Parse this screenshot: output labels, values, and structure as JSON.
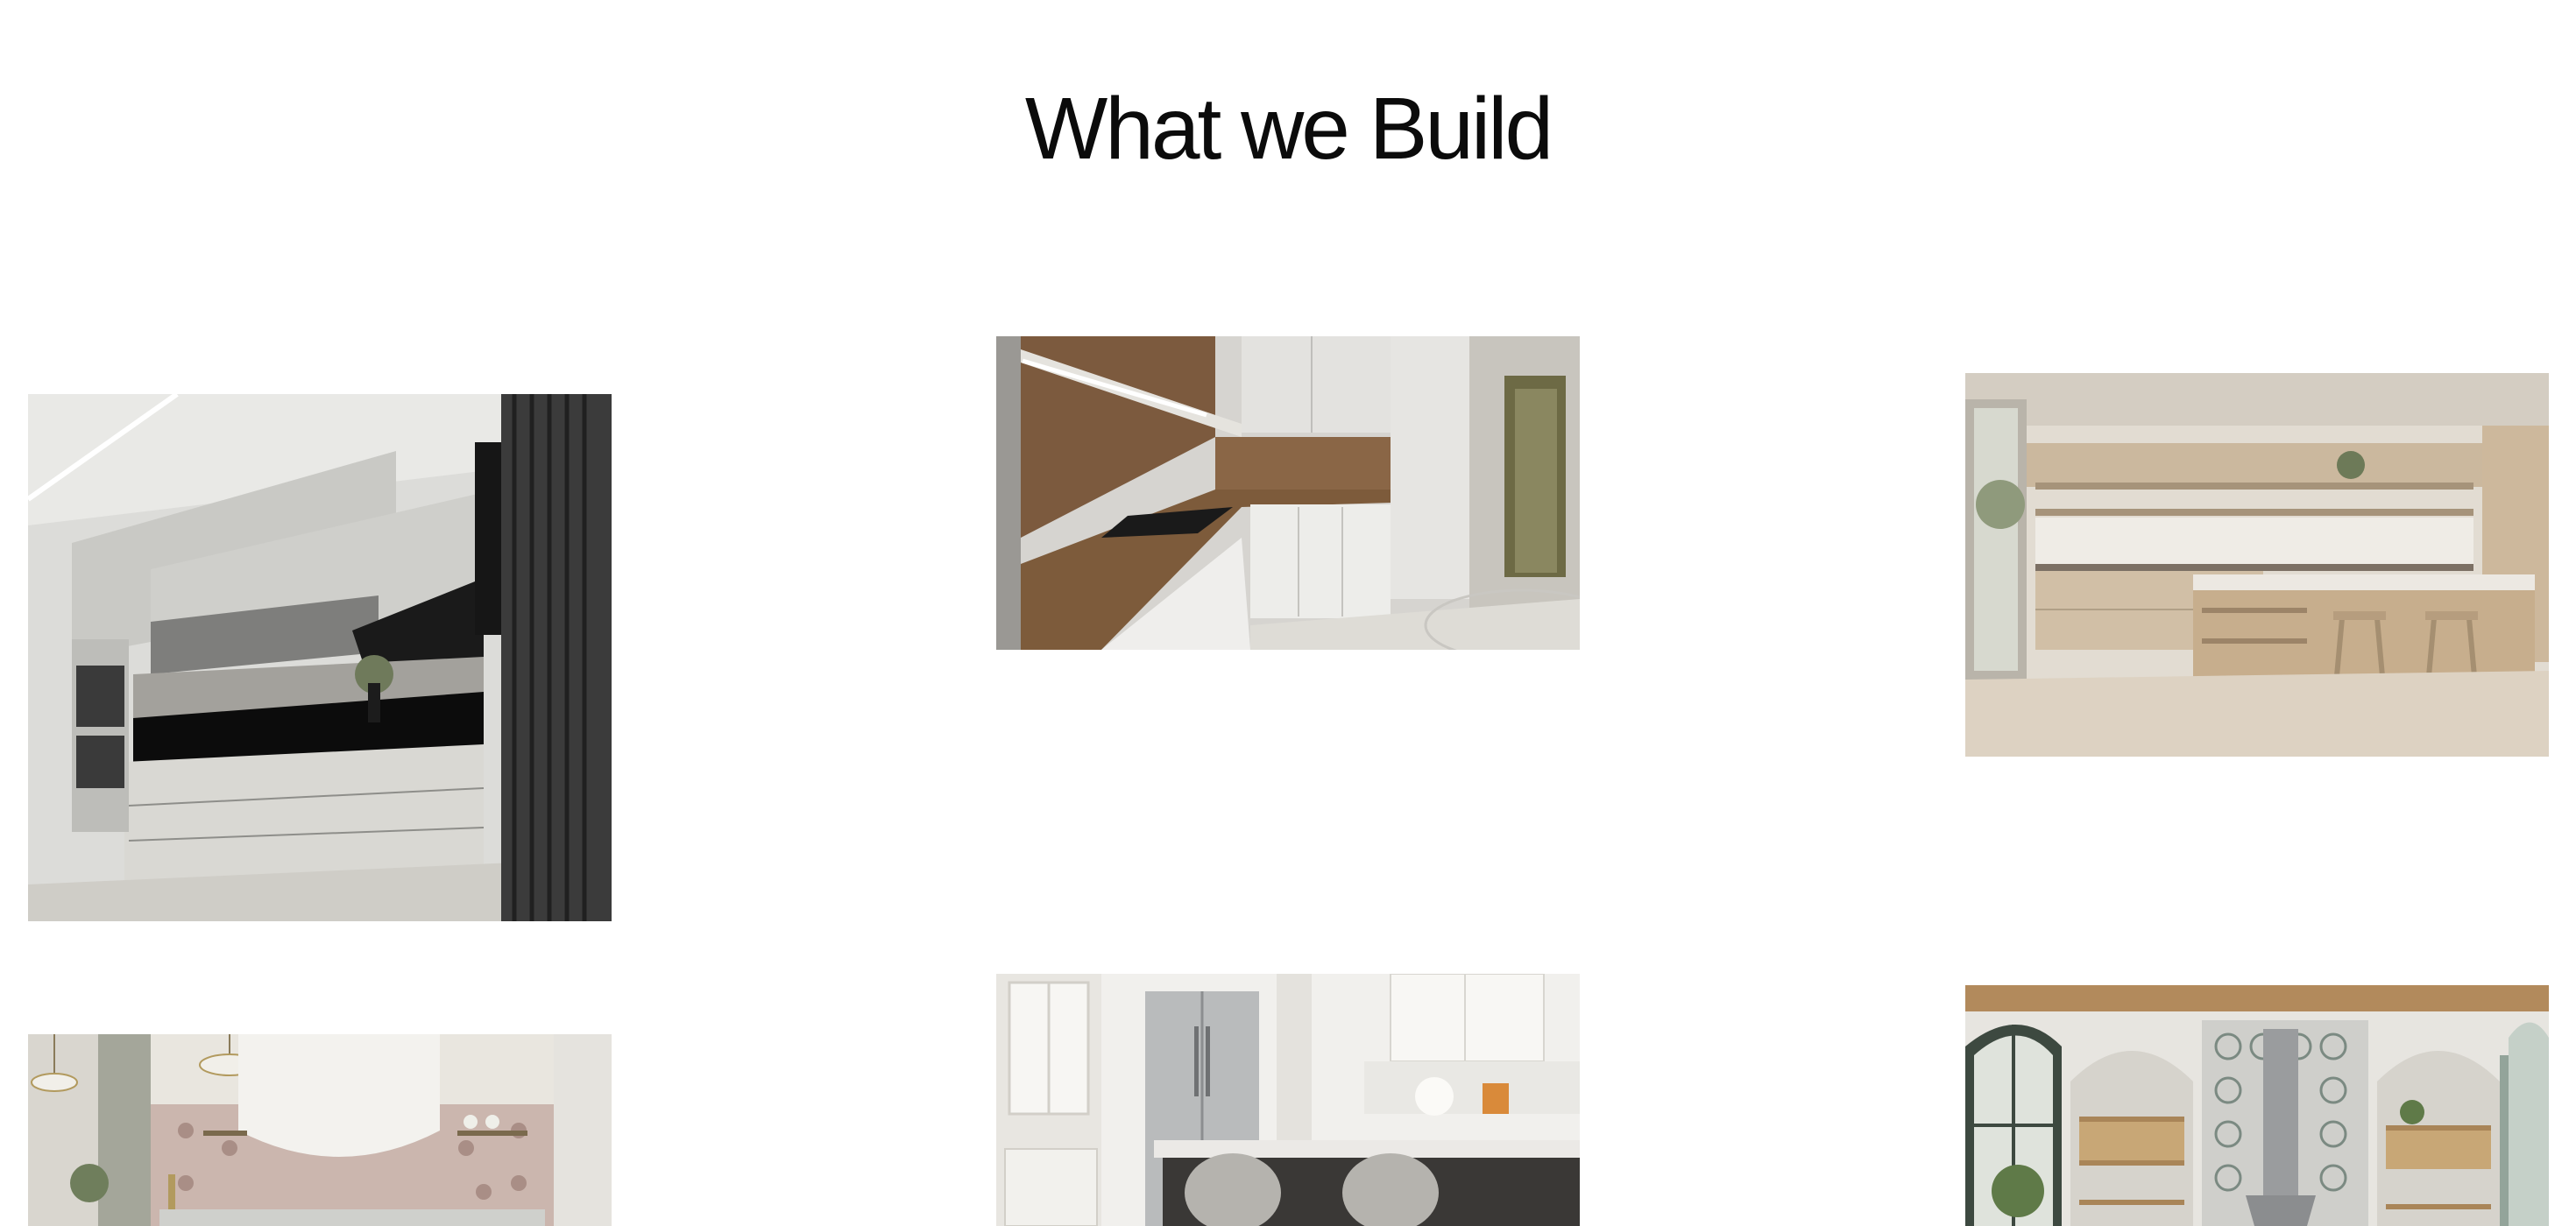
{
  "section": {
    "title": "What we Build"
  },
  "gallery": {
    "items": [
      {
        "name": "kitchen-photo-1"
      },
      {
        "name": "kitchen-photo-2"
      },
      {
        "name": "kitchen-photo-3"
      },
      {
        "name": "kitchen-photo-4"
      },
      {
        "name": "kitchen-photo-5"
      },
      {
        "name": "kitchen-photo-6"
      }
    ]
  },
  "colors": {
    "background": "#ffffff",
    "title": "#0b0b0b"
  }
}
